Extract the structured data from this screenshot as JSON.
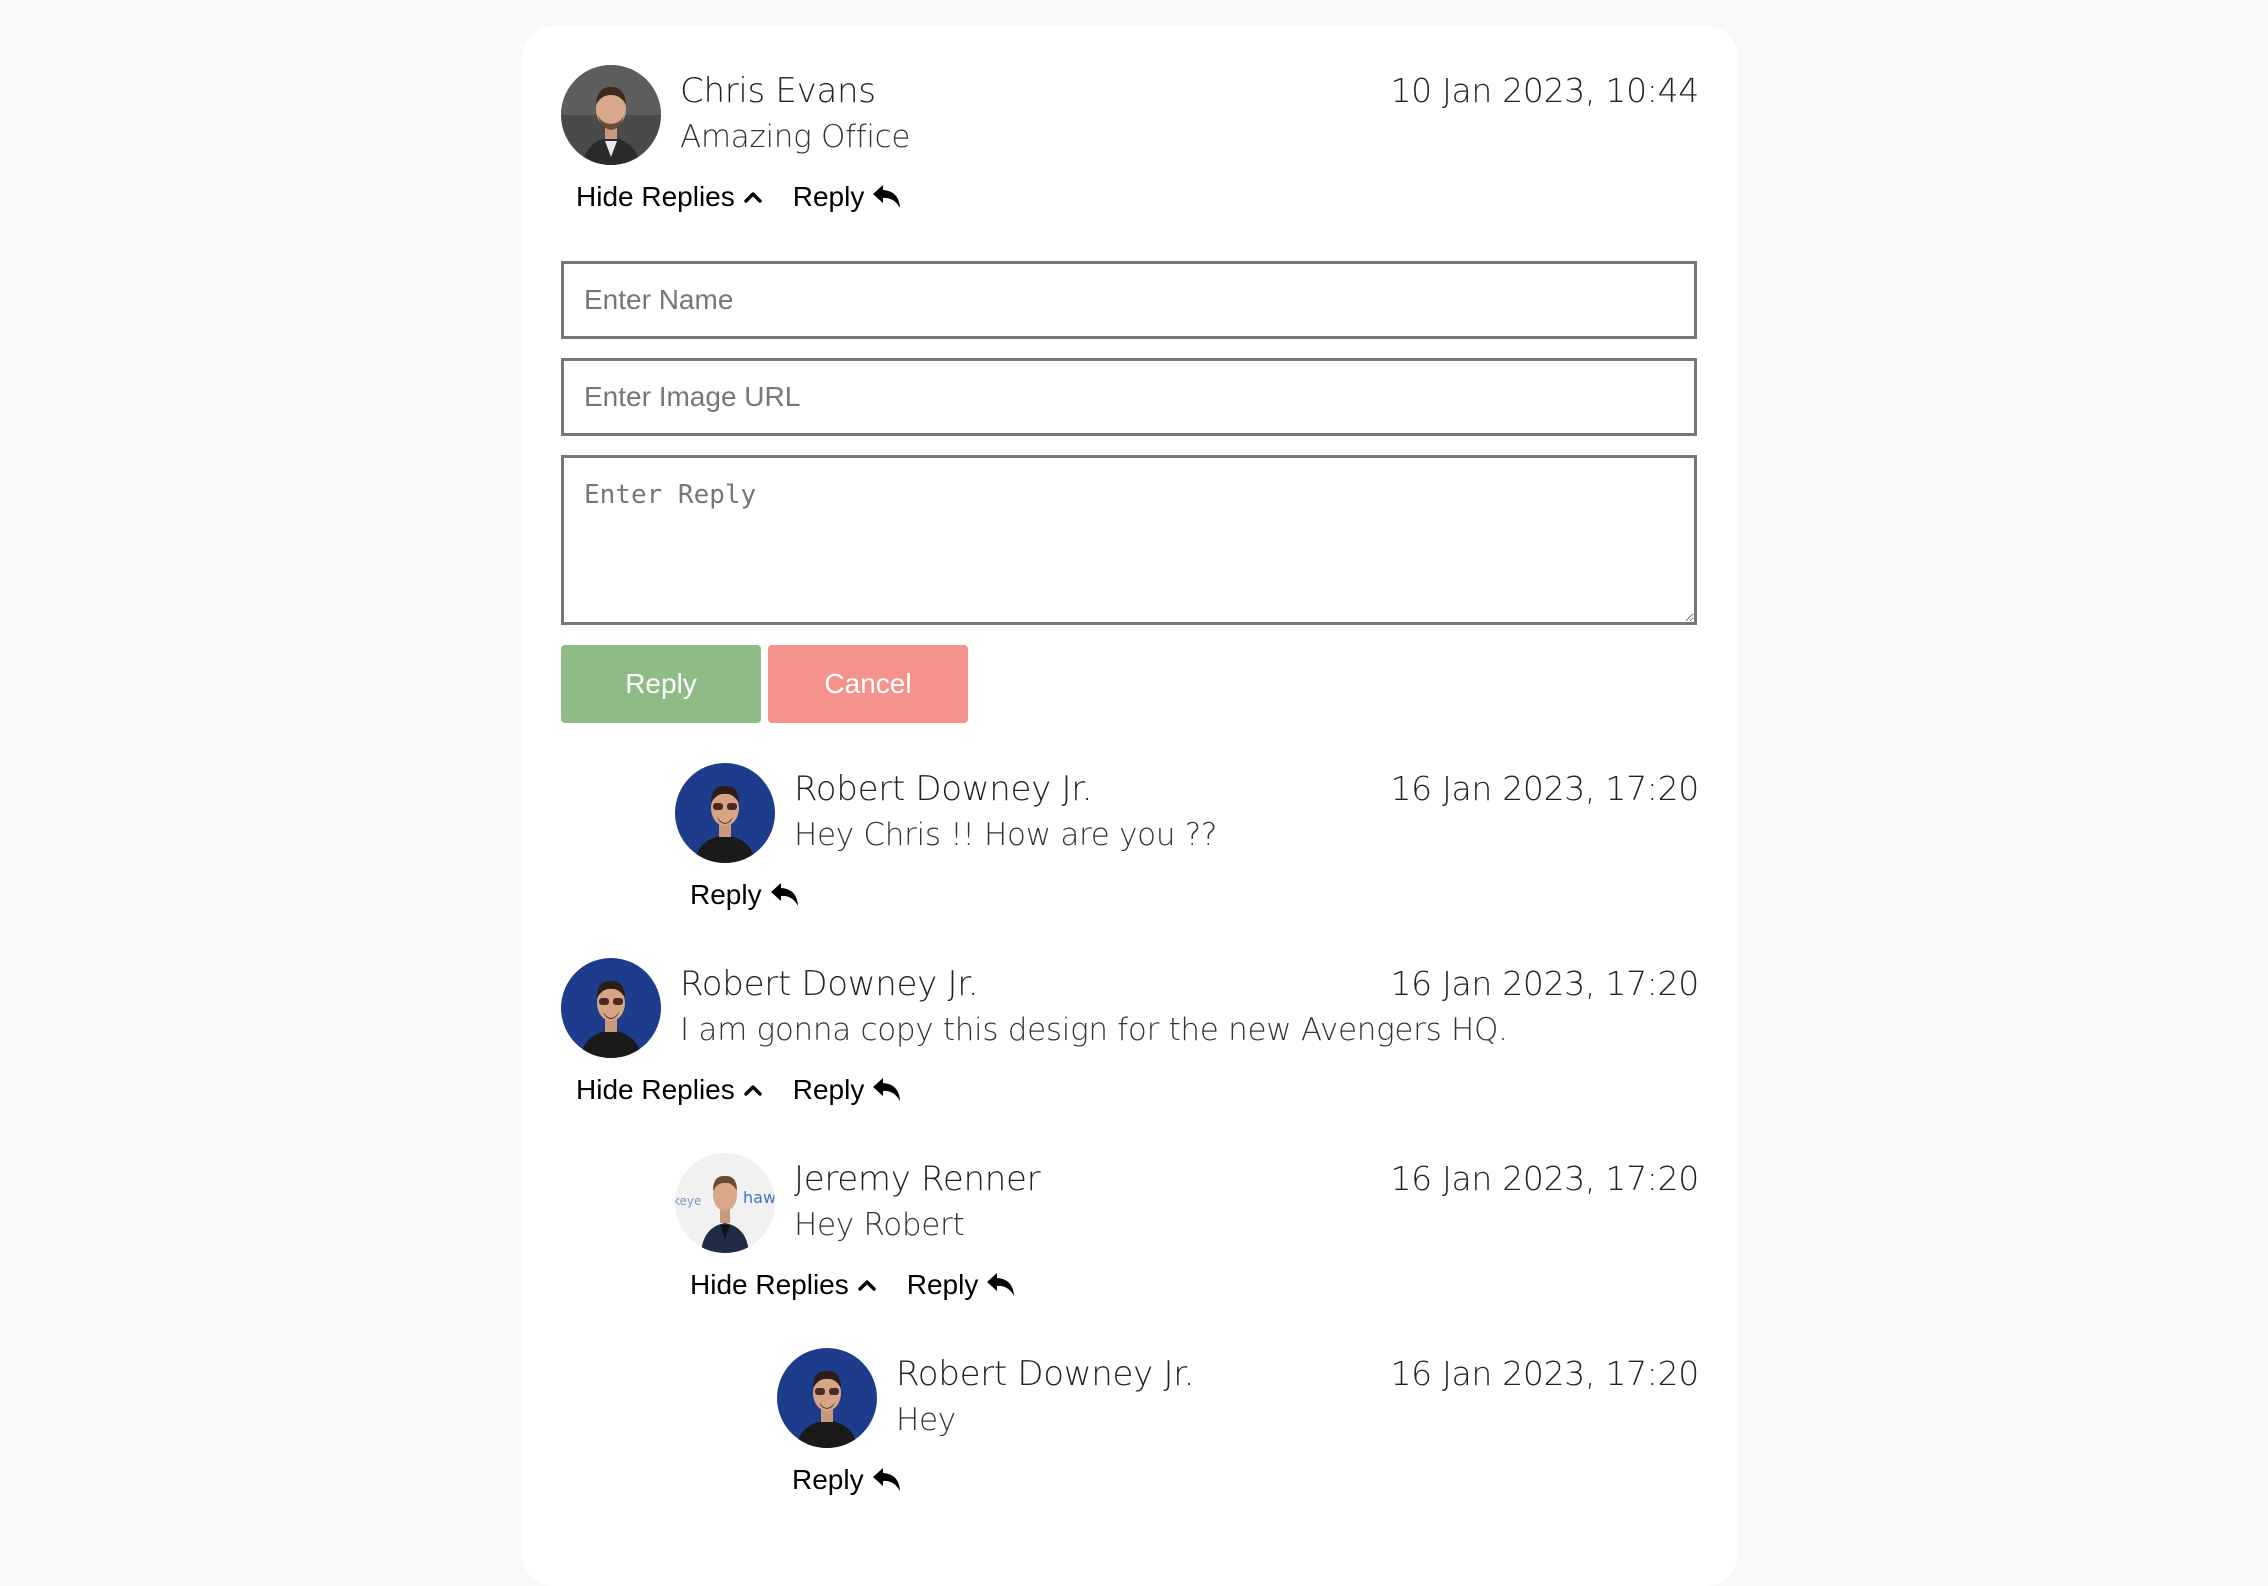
{
  "thread": [
    {
      "author": "Chris Evans",
      "text": "Amazing Office",
      "date": "10 Jan 2023, 10:44",
      "avatar_icon": "avatar-photo-icon",
      "hide_replies_label": "Hide Replies",
      "reply_label": "Reply"
    },
    {
      "author": "Robert Downey Jr.",
      "text": "Hey Chris !! How are you ??",
      "date": "16 Jan 2023, 17:20",
      "avatar_icon": "avatar-photo-icon",
      "reply_label": "Reply"
    },
    {
      "author": "Robert Downey Jr.",
      "text": "I am gonna copy this design for the new Avengers HQ.",
      "date": "16 Jan 2023, 17:20",
      "avatar_icon": "avatar-photo-icon",
      "hide_replies_label": "Hide Replies",
      "reply_label": "Reply"
    },
    {
      "author": "Jeremy Renner",
      "text": "Hey Robert",
      "date": "16 Jan 2023, 17:20",
      "avatar_icon": "avatar-photo-icon",
      "avatar_text": "hawk",
      "avatar_text_2": "keye",
      "hide_replies_label": "Hide Replies",
      "reply_label": "Reply"
    },
    {
      "author": "Robert Downey Jr.",
      "text": "Hey",
      "date": "16 Jan 2023, 17:20",
      "avatar_icon": "avatar-photo-icon",
      "reply_label": "Reply"
    }
  ],
  "reply_form": {
    "name_placeholder": "Enter Name",
    "image_url_placeholder": "Enter Image URL",
    "reply_placeholder": "Enter Reply",
    "submit_label": "Reply",
    "cancel_label": "Cancel"
  },
  "colors": {
    "page_background": "#f7f8fa",
    "card_background": "#ffffff",
    "reply_button": "#8fbb87",
    "cancel_button": "#f4938b",
    "input_border": "#777777"
  },
  "icons": {
    "collapse": "chevron-up-icon",
    "reply": "reply-arrow-icon"
  }
}
